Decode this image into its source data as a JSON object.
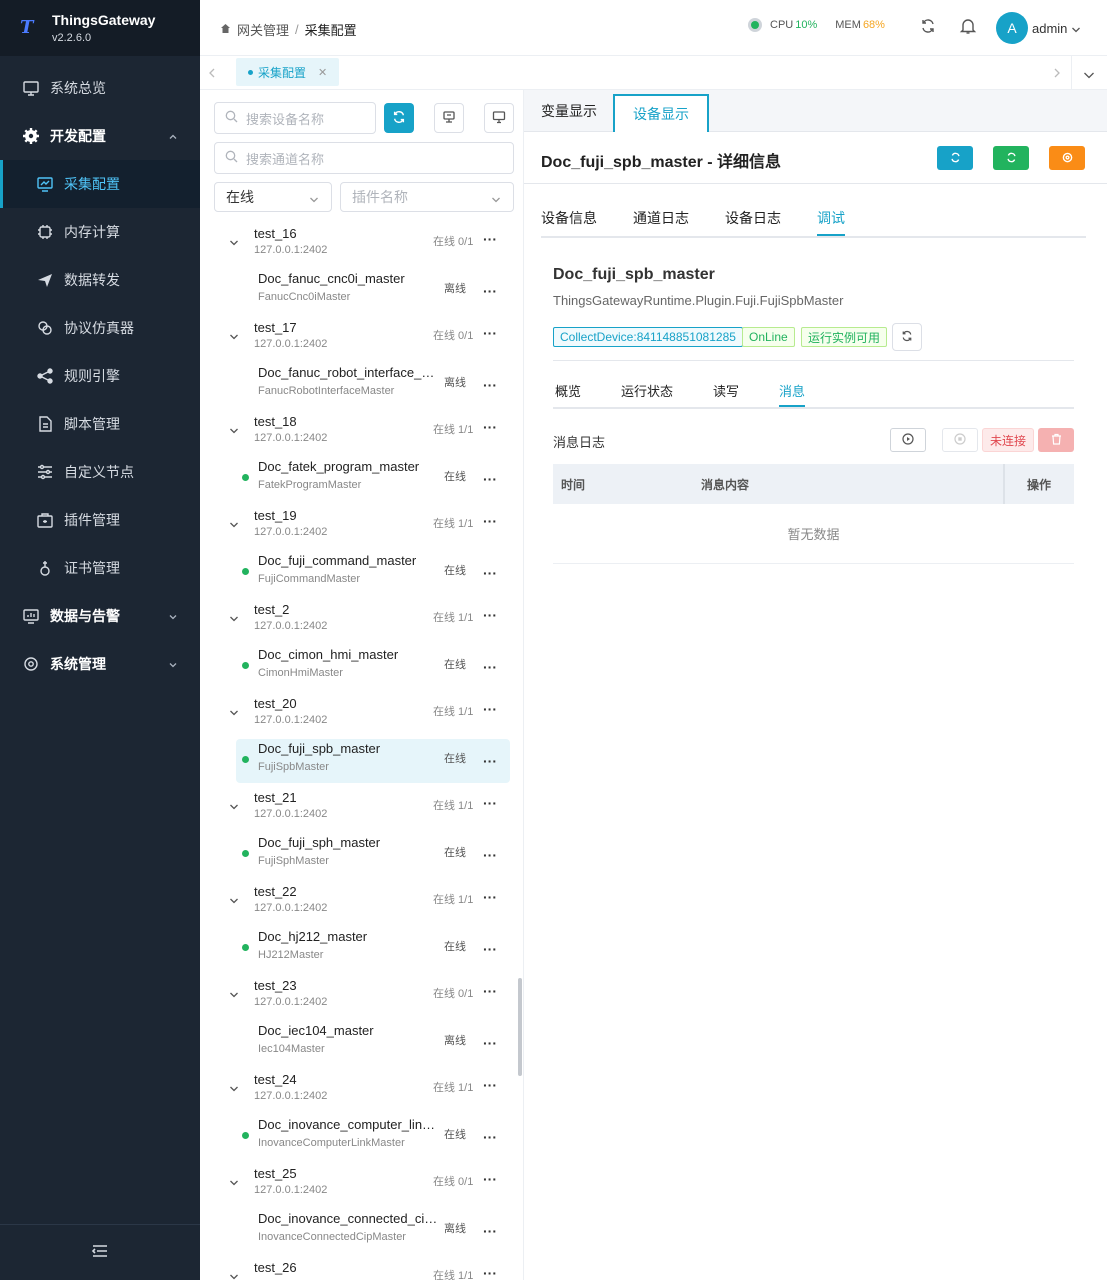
{
  "brand": {
    "name": "ThingsGateway",
    "version": "v2.2.6.0"
  },
  "sidebar": {
    "items": [
      {
        "label": "系统总览",
        "icon": "monitor-icon"
      },
      {
        "label": "开发配置",
        "icon": "gear-icon"
      },
      {
        "label": "采集配置",
        "icon": "chart-screen-icon"
      },
      {
        "label": "内存计算",
        "icon": "chip-icon"
      },
      {
        "label": "数据转发",
        "icon": "send-icon"
      },
      {
        "label": "协议仿真器",
        "icon": "link-icon"
      },
      {
        "label": "规则引擎",
        "icon": "share-icon"
      },
      {
        "label": "脚本管理",
        "icon": "document-icon"
      },
      {
        "label": "自定义节点",
        "icon": "sliders-icon"
      },
      {
        "label": "插件管理",
        "icon": "package-icon"
      },
      {
        "label": "证书管理",
        "icon": "certificate-icon"
      },
      {
        "label": "数据与告警",
        "icon": "dashboard-icon"
      },
      {
        "label": "系统管理",
        "icon": "gear-outline-icon"
      }
    ]
  },
  "header": {
    "breadcrumb_root": "网关管理",
    "breadcrumb_sep": "/",
    "breadcrumb_current": "采集配置",
    "cpu_label": "CPU",
    "cpu_value": "10%",
    "mem_label": "MEM",
    "mem_value": "68%",
    "avatar_letter": "A",
    "username": "admin"
  },
  "tabstrip": {
    "tab_label": "采集配置"
  },
  "left": {
    "device_search_placeholder": "搜索设备名称",
    "channel_search_placeholder": "搜索通道名称",
    "status_filter": "在线",
    "plugin_filter_placeholder": "插件名称",
    "groups": [
      {
        "name": "test_16",
        "ip": "127.0.0.1:2402",
        "status": "在线 0/1",
        "device": "Doc_fanuc_cnc0i_master",
        "plugin": "FanucCnc0iMaster",
        "device_status": "离线",
        "online": false
      },
      {
        "name": "test_17",
        "ip": "127.0.0.1:2402",
        "status": "在线 0/1",
        "device": "Doc_fanuc_robot_interface_master",
        "plugin": "FanucRobotInterfaceMaster",
        "device_status": "离线",
        "online": false
      },
      {
        "name": "test_18",
        "ip": "127.0.0.1:2402",
        "status": "在线 1/1",
        "device": "Doc_fatek_program_master",
        "plugin": "FatekProgramMaster",
        "device_status": "在线",
        "online": true
      },
      {
        "name": "test_19",
        "ip": "127.0.0.1:2402",
        "status": "在线 1/1",
        "device": "Doc_fuji_command_master",
        "plugin": "FujiCommandMaster",
        "device_status": "在线",
        "online": true
      },
      {
        "name": "test_2",
        "ip": "127.0.0.1:2402",
        "status": "在线 1/1",
        "device": "Doc_cimon_hmi_master",
        "plugin": "CimonHmiMaster",
        "device_status": "在线",
        "online": true
      },
      {
        "name": "test_20",
        "ip": "127.0.0.1:2402",
        "status": "在线 1/1",
        "device": "Doc_fuji_spb_master",
        "plugin": "FujiSpbMaster",
        "device_status": "在线",
        "online": true,
        "selected": true
      },
      {
        "name": "test_21",
        "ip": "127.0.0.1:2402",
        "status": "在线 1/1",
        "device": "Doc_fuji_sph_master",
        "plugin": "FujiSphMaster",
        "device_status": "在线",
        "online": true
      },
      {
        "name": "test_22",
        "ip": "127.0.0.1:2402",
        "status": "在线 1/1",
        "device": "Doc_hj212_master",
        "plugin": "HJ212Master",
        "device_status": "在线",
        "online": true
      },
      {
        "name": "test_23",
        "ip": "127.0.0.1:2402",
        "status": "在线 0/1",
        "device": "Doc_iec104_master",
        "plugin": "Iec104Master",
        "device_status": "离线",
        "online": false
      },
      {
        "name": "test_24",
        "ip": "127.0.0.1:2402",
        "status": "在线 1/1",
        "device": "Doc_inovance_computer_link_master",
        "plugin": "InovanceComputerLinkMaster",
        "device_status": "在线",
        "online": true
      },
      {
        "name": "test_25",
        "ip": "127.0.0.1:2402",
        "status": "在线 0/1",
        "device": "Doc_inovance_connected_cip_master",
        "plugin": "InovanceConnectedCipMaster",
        "device_status": "离线",
        "online": false
      },
      {
        "name": "test_26",
        "ip": "",
        "status": "在线 1/1",
        "device": "",
        "plugin": "",
        "device_status": "",
        "online": true
      }
    ]
  },
  "right": {
    "top_tabs": [
      "变量显示",
      "设备显示"
    ],
    "title": "Doc_fuji_spb_master - 详细信息",
    "sub_tabs": [
      "设备信息",
      "通道日志",
      "设备日志",
      "调试"
    ],
    "device_name": "Doc_fuji_spb_master",
    "device_class": "ThingsGatewayRuntime.Plugin.Fuji.FujiSpbMaster",
    "tag_collect": "CollectDevice:841148851081285",
    "tag_online": "OnLine",
    "tag_runtime": "运行实例可用",
    "debug_tabs": [
      "概览",
      "运行状态",
      "读写",
      "消息"
    ],
    "msg_log_label": "消息日志",
    "not_connected": "未连接",
    "col_time": "时间",
    "col_content": "消息内容",
    "col_op": "操作",
    "empty_text": "暂无数据"
  },
  "colors": {
    "accent": "#17a2c8",
    "success": "#22b35e",
    "warning": "#f5a623",
    "sidebar_bg": "#1c2633"
  }
}
